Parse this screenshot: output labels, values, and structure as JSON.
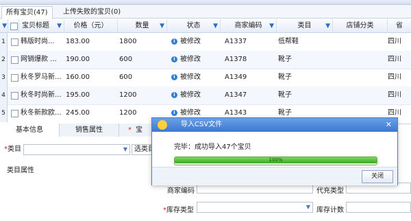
{
  "tabs": [
    {
      "label": "所有宝贝(47)",
      "active": true
    },
    {
      "label": "上传失败的宝贝(0)",
      "active": false
    }
  ],
  "grid": {
    "columns": [
      "宝贝标题",
      "价格（元）",
      "数量",
      "状态",
      "商家编码",
      "类目",
      "店铺分类",
      "省"
    ],
    "rows": [
      {
        "num": "1",
        "title": "韩版时尚...",
        "price": "183.00",
        "qty": "1800",
        "status": "被修改",
        "code": "A1337",
        "category": "低帮鞋",
        "province": "四川"
      },
      {
        "num": "2",
        "title": "网销爆款 ...",
        "price": "190.00",
        "qty": "600",
        "status": "被修改",
        "code": "A1378",
        "category": "靴子",
        "province": "四川"
      },
      {
        "num": "3",
        "title": "秋冬罗马新...",
        "price": "160.00",
        "qty": "600",
        "status": "被修改",
        "code": "A1349",
        "category": "靴子",
        "province": "四川"
      },
      {
        "num": "4",
        "title": "秋冬时尚新...",
        "price": "195.00",
        "qty": "1200",
        "status": "被修改",
        "code": "A1347",
        "category": "靴子",
        "province": "四川"
      },
      {
        "num": "5",
        "title": "秋冬新款欧...",
        "price": "245.00",
        "qty": "1200",
        "status": "被修改",
        "code": "A1343",
        "category": "靴子",
        "province": "四川"
      }
    ]
  },
  "bottom": {
    "tabs": [
      "基本信息",
      "销售属性",
      "宝"
    ],
    "category_label": "类目",
    "select_category_button": "选类目",
    "category_attr_label": "类目属性",
    "merchant_code_label": "商家编码",
    "proxy_type_label": "代充类型",
    "stock_type_label": "库存类型",
    "stock_count_label": "库存计数",
    "required_mark": "*"
  },
  "dialog": {
    "title": "导入CSV文件",
    "message": "完毕：成功导入47个宝贝",
    "progress_percent": 100,
    "progress_text": "100%",
    "close_button": "关闭",
    "close_glyph": "✕"
  },
  "colors": {
    "accent": "#3d78cf",
    "progress": "#3ea52a"
  }
}
